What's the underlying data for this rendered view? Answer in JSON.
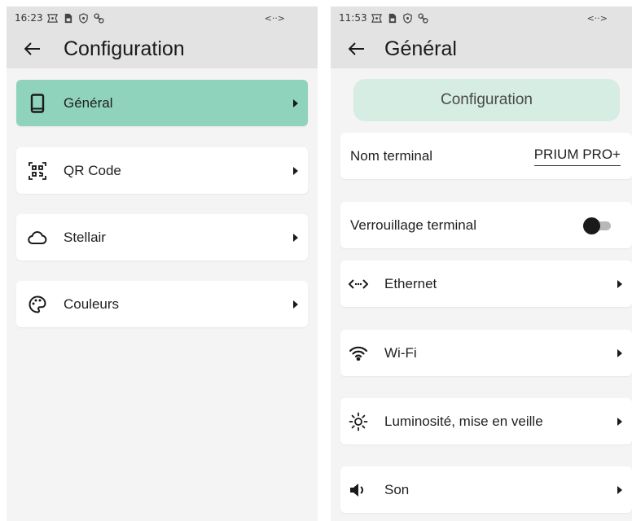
{
  "left": {
    "status": {
      "time": "16:23",
      "right_indicator": "<··>"
    },
    "title": "Configuration",
    "menu": [
      {
        "label": "Général",
        "icon": "phone-icon",
        "active": true
      },
      {
        "label": "QR Code",
        "icon": "qr-code-icon",
        "active": false
      },
      {
        "label": "Stellair",
        "icon": "cloud-icon",
        "active": false
      },
      {
        "label": "Couleurs",
        "icon": "palette-icon",
        "active": false
      }
    ]
  },
  "right": {
    "status": {
      "time": "11:53",
      "right_indicator": "<··>"
    },
    "title": "Général",
    "config_button": "Configuration",
    "terminal_name": {
      "label": "Nom terminal",
      "value": "PRIUM PRO+"
    },
    "terminal_lock": {
      "label": "Verrouillage terminal",
      "enabled": false
    },
    "menu": [
      {
        "label": "Ethernet",
        "icon": "ethernet-icon"
      },
      {
        "label": "Wi-Fi",
        "icon": "wifi-icon"
      },
      {
        "label": "Luminosité, mise en veille",
        "icon": "brightness-icon"
      },
      {
        "label": "Son",
        "icon": "volume-icon"
      }
    ]
  },
  "colors": {
    "accent": "#8fd3bd",
    "config_button_bg": "#d6ede4",
    "bar_bg": "#e3e3e3",
    "screen_bg": "#f4f4f4"
  }
}
